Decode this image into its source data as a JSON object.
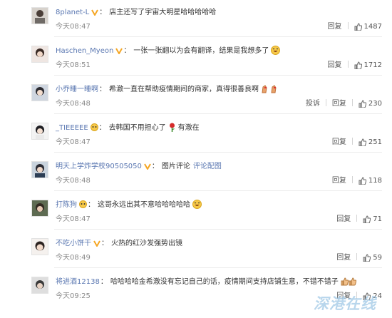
{
  "colors": {
    "username": "#5a77b1",
    "text": "#333333",
    "meta": "#8a8a8a",
    "badge": "#f5a623"
  },
  "comments": [
    {
      "username": "8planet-L",
      "verified": true,
      "text": "店主还写了宇宙大明星哈哈哈哈哈",
      "time": "今天08:47",
      "reply_label": "回复",
      "likes": "1487",
      "avatar_icon": "avatar-photo-icon"
    },
    {
      "username": "Haschen_Myeon",
      "verified": true,
      "text": "一张一张翻以为会有翻译，结果是我想多了",
      "emoji": "laughing-emoji-icon",
      "time": "今天08:51",
      "reply_label": "回复",
      "likes": "1712",
      "avatar_icon": "avatar-photo-icon"
    },
    {
      "username": "小乔睡一睡啊",
      "verified": false,
      "text": "希澈一直在帮助疫情期间的商家，真得很善良啊",
      "emoji": "hands-emoji-icon",
      "time": "今天08:48",
      "report_label": "投诉",
      "reply_label": "回复",
      "likes": "230",
      "avatar_icon": "avatar-photo-icon"
    },
    {
      "username": "_TIEEEEE",
      "verified": false,
      "text": "去韩国不用担心了",
      "text2": "有澈在",
      "emoji": "rose-emoji-icon",
      "time": "今天08:47",
      "reply_label": "回复",
      "likes": "251",
      "avatar_icon": "avatar-photo-icon"
    },
    {
      "username": "明天上学炸学校90505050",
      "verified": true,
      "text": "图片评论",
      "link": "评论配图",
      "time": "今天08:48",
      "reply_label": "回复",
      "likes": "118",
      "avatar_icon": "avatar-photo-icon"
    },
    {
      "username": "打陈狗",
      "verified": false,
      "text": "这哥永远出其不意哈哈哈哈哈",
      "emoji": "laughing-emoji-icon",
      "time": "今天08:47",
      "reply_label": "回复",
      "likes": "71",
      "avatar_icon": "avatar-photo-icon"
    },
    {
      "username": "不吃小饼干",
      "verified": true,
      "text": "火热的红沙发强势出镜",
      "time": "今天08:49",
      "reply_label": "回复",
      "likes": "59",
      "avatar_icon": "avatar-photo-icon"
    },
    {
      "username": "将进酒12138",
      "verified": false,
      "text": "哈哈哈哈金希澈没有忘记自己的话，疫情期间支持店铺生意，不错不错子",
      "emoji": "thumbs-emoji-icon",
      "time": "今天09:25",
      "reply_label": "回复",
      "likes": "24",
      "avatar_icon": "avatar-photo-icon"
    }
  ],
  "watermark": "深港在线"
}
